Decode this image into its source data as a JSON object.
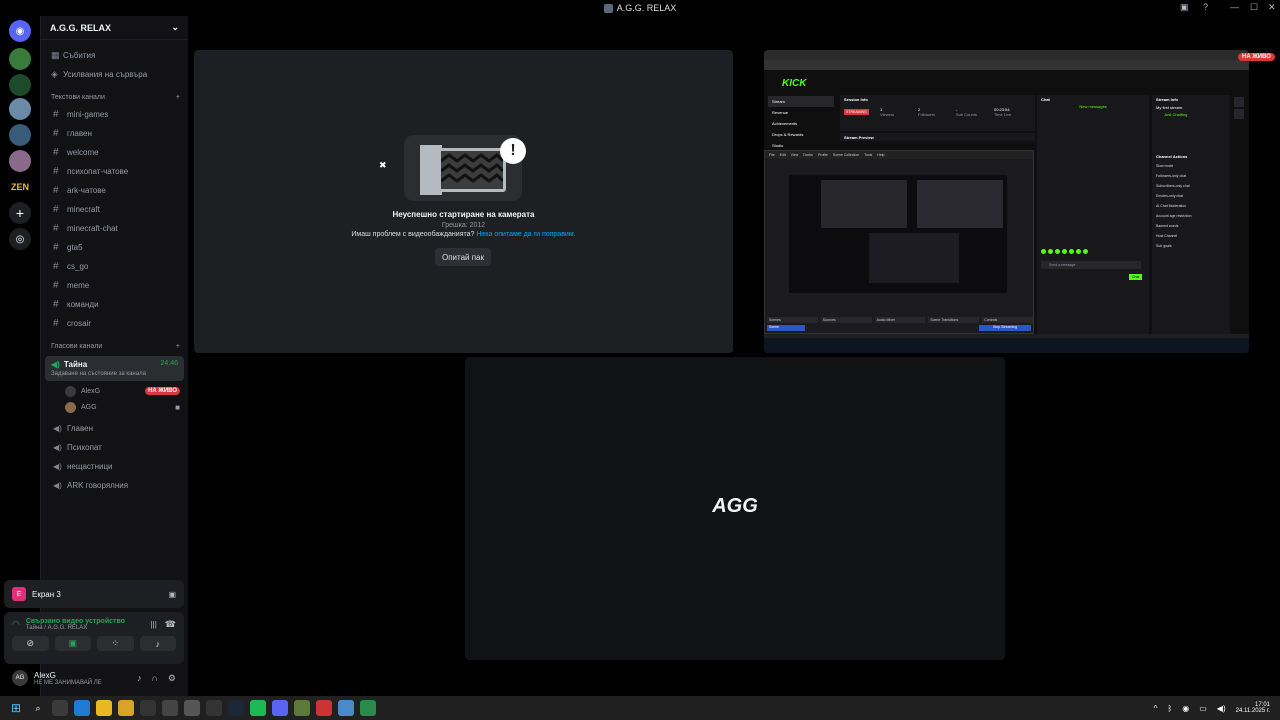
{
  "window": {
    "title": "A.G.G. RELAX"
  },
  "server": {
    "name": "A.G.G. RELAX",
    "top_items": [
      {
        "label": "Събития",
        "icon": "calendar-icon"
      },
      {
        "label": "Усилвания на сървъра",
        "icon": "boost-icon"
      }
    ],
    "text_category": "Текстови канали",
    "text_channels": [
      "mini-games",
      "главен",
      "welcome",
      "психопат-чатове",
      "ark-чатове",
      "minecraft",
      "minecraft-chat",
      "gta5",
      "cs_go",
      "meme",
      "команди",
      "crosair"
    ],
    "voice_category": "Гласови канали",
    "active_voice": {
      "name": "Тайна",
      "time": "24:46",
      "status": "Задаване на състояние за канала"
    },
    "voice_users": [
      {
        "name": "AlexG",
        "badge": "НА ЖИВО"
      },
      {
        "name": "AGG"
      }
    ],
    "voice_channels": [
      "Главен",
      "Психопат",
      "нещастници",
      "ARK говорялния"
    ]
  },
  "screen_share": {
    "label": "Екран 3"
  },
  "connection": {
    "status": "Свързано видео устройство",
    "location": "Тайна / A.G.G. RELAX"
  },
  "user": {
    "name": "AlexG",
    "status": "НЕ МЕ ЗАНИМАВАЙ ЛЕ"
  },
  "camera_error": {
    "title": "Неуспешно стартиране на камерата",
    "code": "Грешка: 2012",
    "question": "Имаш проблем с видеообажданията?",
    "link": "Нека опитаме да ги поправим.",
    "retry": "Опитай пак"
  },
  "stream_tile": {
    "live_badge": "НА ЖИВО",
    "kick": {
      "logo": "KICK",
      "nav": [
        "Stream",
        "Revenue",
        "Achievements",
        "Drops & Rewards",
        "Studio"
      ],
      "session_info": "Session Info",
      "streaming_badge": "STREAMING",
      "stats": [
        {
          "value": "1",
          "label": "Viewers"
        },
        {
          "value": "2",
          "label": "Followers"
        },
        {
          "value": "-",
          "label": "Sub Counts"
        },
        {
          "value": "00:23:54",
          "label": "Time Live"
        }
      ],
      "stream_preview": "Stream Preview",
      "chat_title": "Chat",
      "new_messages": "New messages",
      "send_placeholder": "Send a message",
      "chat_button": "Chat",
      "stream_info": "Stream Info",
      "stream_title": "My first stream.",
      "category": "Just Chatting",
      "channel_actions": "Channel Actions",
      "actions": [
        "Slow mode",
        "Followers-only chat",
        "Subscribers-only chat",
        "Emotes-only chat",
        "AI Chat Moderation",
        "Account age restriction",
        "Banned words",
        "Host Channel",
        "Sub goals"
      ]
    },
    "obs": {
      "menu": [
        "File",
        "Edit",
        "View",
        "Docks",
        "Profile",
        "Scene Collection",
        "Tools",
        "Help"
      ],
      "docks": [
        "Scenes",
        "Sources",
        "Audio Mixer",
        "Scene Transitions",
        "Controls"
      ],
      "scene": "Scene",
      "stop_button": "Stop Streaming"
    }
  },
  "agg_tile": {
    "logo": "AGG"
  },
  "taskbar": {
    "time": "17:01",
    "date": "24.11.2025 г."
  },
  "colors": {
    "live": "#da373c",
    "kick_green": "#53fc18",
    "discord_green": "#23a55a",
    "blurple": "#5865f2"
  }
}
